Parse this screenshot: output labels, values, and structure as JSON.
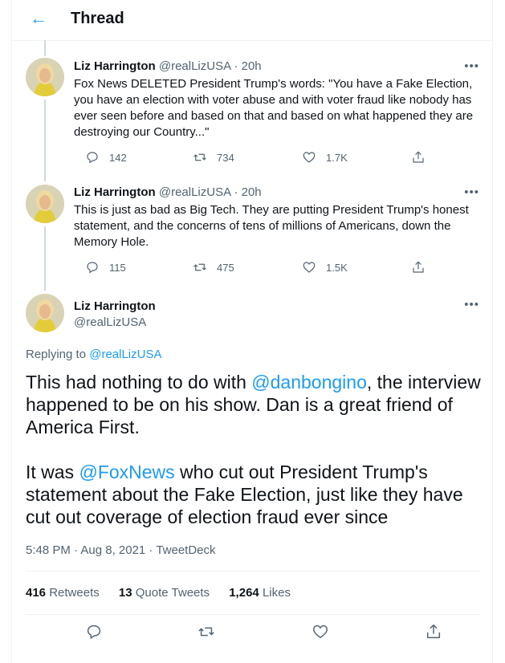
{
  "header": {
    "back_icon": "arrow-left-icon",
    "title": "Thread"
  },
  "tweets": [
    {
      "name": "Liz Harrington",
      "handle": "@realLizUSA",
      "time": "· 20h",
      "text": "Fox News DELETED President Trump's words: \"You have a Fake Election, you have an election with voter abuse and with voter fraud like nobody has ever seen before and based on that and based on what happened they are destroying our Country...\"",
      "replies": "142",
      "retweets": "734",
      "likes": "1.7K"
    },
    {
      "name": "Liz Harrington",
      "handle": "@realLizUSA",
      "time": "· 20h",
      "text": "This is just as bad as Big Tech. They are putting President Trump's honest statement, and the concerns of tens of millions of Americans, down the Memory Hole.",
      "replies": "115",
      "retweets": "475",
      "likes": "1.5K"
    }
  ],
  "main": {
    "name": "Liz Harrington",
    "handle": "@realLizUSA",
    "replying_prefix": "Replying to",
    "replying_to": "@realLizUSA",
    "p1_a": "This had nothing to do with ",
    "p1_mention": "@danbongino",
    "p1_b": ", the interview happened to be on his show. Dan is a great friend of America First.",
    "p2_a": "It was ",
    "p2_mention": "@FoxNews",
    "p2_b": " who cut out President Trump's statement about the Fake Election, just like they have cut out coverage of election fraud ever since",
    "meta": "5:48 PM · Aug 8, 2021 · TweetDeck",
    "retweets_count": "416",
    "retweets_label": "Retweets",
    "quotes_count": "13",
    "quotes_label": "Quote Tweets",
    "likes_count": "1,264",
    "likes_label": "Likes"
  },
  "more_label": "•••",
  "colors": {
    "accent": "#1d9bf0",
    "secondary": "#536471",
    "border": "#eff3f4"
  }
}
